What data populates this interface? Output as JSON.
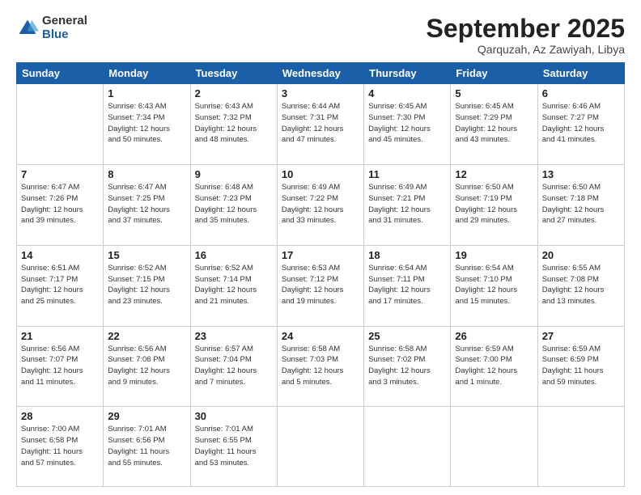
{
  "logo": {
    "general": "General",
    "blue": "Blue"
  },
  "title": "September 2025",
  "location": "Qarquzah, Az Zawiyah, Libya",
  "headers": [
    "Sunday",
    "Monday",
    "Tuesday",
    "Wednesday",
    "Thursday",
    "Friday",
    "Saturday"
  ],
  "weeks": [
    [
      {
        "day": "",
        "info": ""
      },
      {
        "day": "1",
        "info": "Sunrise: 6:43 AM\nSunset: 7:34 PM\nDaylight: 12 hours\nand 50 minutes."
      },
      {
        "day": "2",
        "info": "Sunrise: 6:43 AM\nSunset: 7:32 PM\nDaylight: 12 hours\nand 48 minutes."
      },
      {
        "day": "3",
        "info": "Sunrise: 6:44 AM\nSunset: 7:31 PM\nDaylight: 12 hours\nand 47 minutes."
      },
      {
        "day": "4",
        "info": "Sunrise: 6:45 AM\nSunset: 7:30 PM\nDaylight: 12 hours\nand 45 minutes."
      },
      {
        "day": "5",
        "info": "Sunrise: 6:45 AM\nSunset: 7:29 PM\nDaylight: 12 hours\nand 43 minutes."
      },
      {
        "day": "6",
        "info": "Sunrise: 6:46 AM\nSunset: 7:27 PM\nDaylight: 12 hours\nand 41 minutes."
      }
    ],
    [
      {
        "day": "7",
        "info": "Sunrise: 6:47 AM\nSunset: 7:26 PM\nDaylight: 12 hours\nand 39 minutes."
      },
      {
        "day": "8",
        "info": "Sunrise: 6:47 AM\nSunset: 7:25 PM\nDaylight: 12 hours\nand 37 minutes."
      },
      {
        "day": "9",
        "info": "Sunrise: 6:48 AM\nSunset: 7:23 PM\nDaylight: 12 hours\nand 35 minutes."
      },
      {
        "day": "10",
        "info": "Sunrise: 6:49 AM\nSunset: 7:22 PM\nDaylight: 12 hours\nand 33 minutes."
      },
      {
        "day": "11",
        "info": "Sunrise: 6:49 AM\nSunset: 7:21 PM\nDaylight: 12 hours\nand 31 minutes."
      },
      {
        "day": "12",
        "info": "Sunrise: 6:50 AM\nSunset: 7:19 PM\nDaylight: 12 hours\nand 29 minutes."
      },
      {
        "day": "13",
        "info": "Sunrise: 6:50 AM\nSunset: 7:18 PM\nDaylight: 12 hours\nand 27 minutes."
      }
    ],
    [
      {
        "day": "14",
        "info": "Sunrise: 6:51 AM\nSunset: 7:17 PM\nDaylight: 12 hours\nand 25 minutes."
      },
      {
        "day": "15",
        "info": "Sunrise: 6:52 AM\nSunset: 7:15 PM\nDaylight: 12 hours\nand 23 minutes."
      },
      {
        "day": "16",
        "info": "Sunrise: 6:52 AM\nSunset: 7:14 PM\nDaylight: 12 hours\nand 21 minutes."
      },
      {
        "day": "17",
        "info": "Sunrise: 6:53 AM\nSunset: 7:12 PM\nDaylight: 12 hours\nand 19 minutes."
      },
      {
        "day": "18",
        "info": "Sunrise: 6:54 AM\nSunset: 7:11 PM\nDaylight: 12 hours\nand 17 minutes."
      },
      {
        "day": "19",
        "info": "Sunrise: 6:54 AM\nSunset: 7:10 PM\nDaylight: 12 hours\nand 15 minutes."
      },
      {
        "day": "20",
        "info": "Sunrise: 6:55 AM\nSunset: 7:08 PM\nDaylight: 12 hours\nand 13 minutes."
      }
    ],
    [
      {
        "day": "21",
        "info": "Sunrise: 6:56 AM\nSunset: 7:07 PM\nDaylight: 12 hours\nand 11 minutes."
      },
      {
        "day": "22",
        "info": "Sunrise: 6:56 AM\nSunset: 7:06 PM\nDaylight: 12 hours\nand 9 minutes."
      },
      {
        "day": "23",
        "info": "Sunrise: 6:57 AM\nSunset: 7:04 PM\nDaylight: 12 hours\nand 7 minutes."
      },
      {
        "day": "24",
        "info": "Sunrise: 6:58 AM\nSunset: 7:03 PM\nDaylight: 12 hours\nand 5 minutes."
      },
      {
        "day": "25",
        "info": "Sunrise: 6:58 AM\nSunset: 7:02 PM\nDaylight: 12 hours\nand 3 minutes."
      },
      {
        "day": "26",
        "info": "Sunrise: 6:59 AM\nSunset: 7:00 PM\nDaylight: 12 hours\nand 1 minute."
      },
      {
        "day": "27",
        "info": "Sunrise: 6:59 AM\nSunset: 6:59 PM\nDaylight: 11 hours\nand 59 minutes."
      }
    ],
    [
      {
        "day": "28",
        "info": "Sunrise: 7:00 AM\nSunset: 6:58 PM\nDaylight: 11 hours\nand 57 minutes."
      },
      {
        "day": "29",
        "info": "Sunrise: 7:01 AM\nSunset: 6:56 PM\nDaylight: 11 hours\nand 55 minutes."
      },
      {
        "day": "30",
        "info": "Sunrise: 7:01 AM\nSunset: 6:55 PM\nDaylight: 11 hours\nand 53 minutes."
      },
      {
        "day": "",
        "info": ""
      },
      {
        "day": "",
        "info": ""
      },
      {
        "day": "",
        "info": ""
      },
      {
        "day": "",
        "info": ""
      }
    ]
  ]
}
